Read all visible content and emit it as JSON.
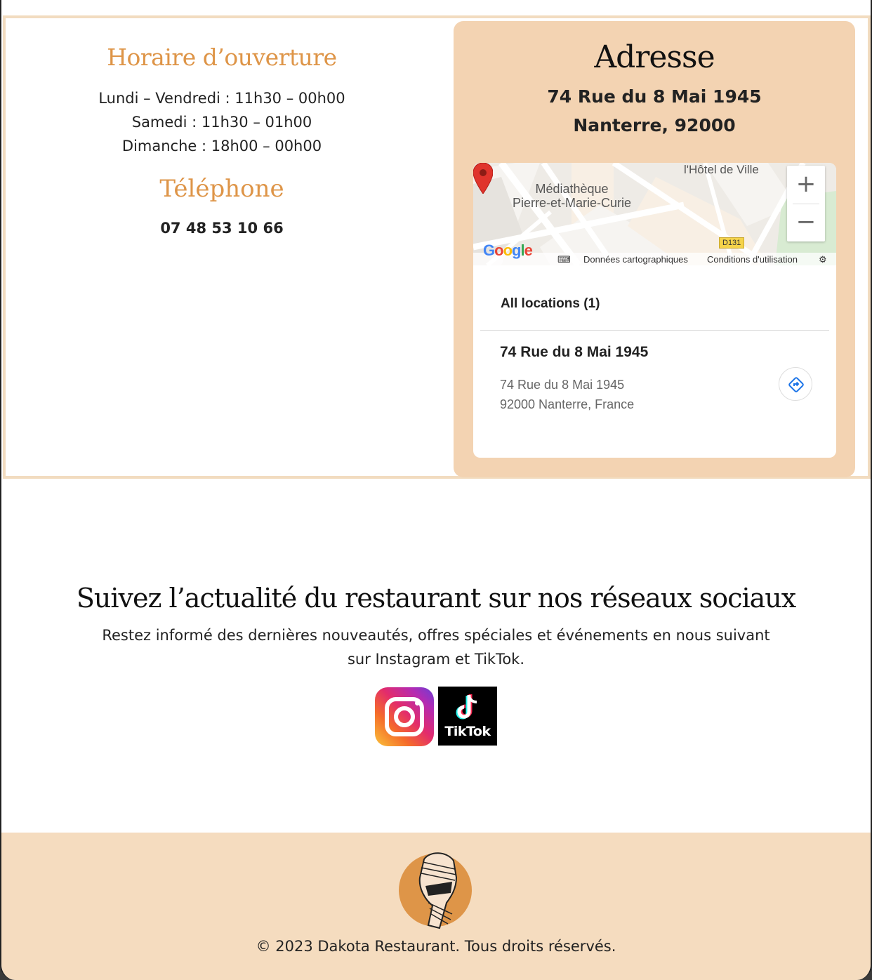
{
  "hours": {
    "title": "Horaire d’ouverture",
    "lines": [
      "Lundi – Vendredi : 11h30 – 00h00",
      "Samedi : 11h30 – 01h00",
      "Dimanche : 18h00 – 00h00"
    ]
  },
  "phone": {
    "title": "Téléphone",
    "number": "07 48 53 10 66"
  },
  "address": {
    "title": "Adresse",
    "line1": "74 Rue du 8 Mai 1945",
    "line2": "Nanterre, 92000"
  },
  "map": {
    "label_hotel": "l'Hôtel de Ville",
    "label_media_line1": "Médiathèque",
    "label_media_line2": "Pierre-et-Marie-Curie",
    "zoom_in": "+",
    "zoom_out": "−",
    "route_badge": "D131",
    "google_logo": "Google",
    "data_link": "Données cartographiques",
    "terms_link": "Conditions d'utilisation",
    "all_locations": "All locations (1)",
    "location_name": "74 Rue du 8 Mai 1945",
    "location_addr1": "74 Rue du 8 Mai 1945",
    "location_addr2": "92000 Nanterre, France",
    "pin_color": "#e0342c",
    "directions_color": "#1a73e8"
  },
  "social": {
    "title": "Suivez l’actualité du restaurant sur nos réseaux sociaux",
    "text": "Restez informé des dernières nouveautés, offres spéciales et événements en nous suivant sur Instagram et TikTok.",
    "tiktok_label": "TikTok",
    "icons": [
      "instagram-icon",
      "tiktok-icon"
    ]
  },
  "footer": {
    "copyright": "© 2023 Dakota Restaurant. Tous droits réservés.",
    "background": "#f5dcbf",
    "logo_color": "#de9548"
  },
  "colors": {
    "accent": "#de9548",
    "panel": "#f3d3b2"
  }
}
